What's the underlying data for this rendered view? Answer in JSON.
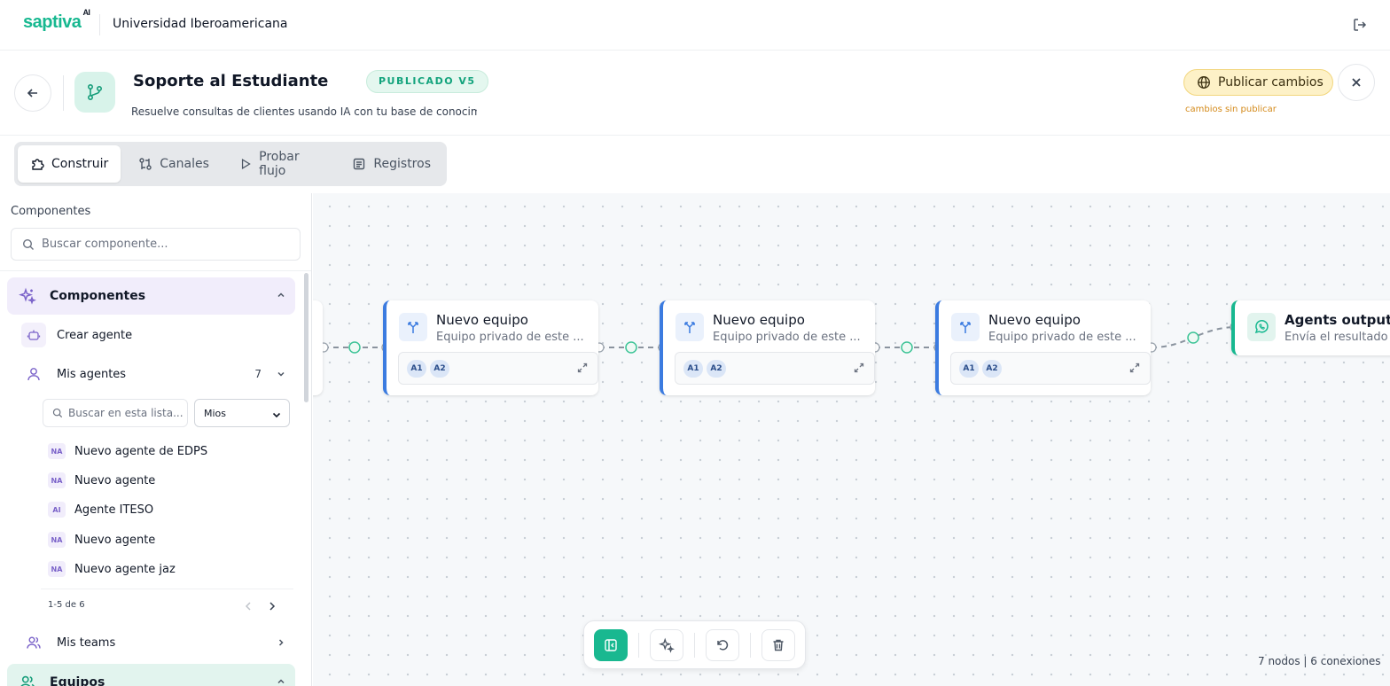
{
  "topbar": {
    "logo": "saptiva",
    "logo_sup": "AI",
    "org_name": "Universidad Iberoamericana"
  },
  "header": {
    "title": "Soporte al Estudiante",
    "status": "PUBLICADO V5",
    "description": "Resuelve consultas de clientes usando IA con tu base de conocimiento",
    "publish_label": "Publicar cambios",
    "unpublished_note": "cambios sin publicar"
  },
  "tabs": [
    {
      "label": "Construir",
      "active": true
    },
    {
      "label": "Canales",
      "active": false
    },
    {
      "label": "Probar flujo",
      "active": false
    },
    {
      "label": "Registros",
      "active": false
    }
  ],
  "sidebar": {
    "title": "Componentes",
    "search_placeholder": "Buscar componente...",
    "components_section": "Componentes",
    "create_agent": "Crear agente",
    "my_agents": "Mis agentes",
    "my_agents_count": "7",
    "list_search_placeholder": "Buscar en esta lista...",
    "list_filter": "Mios",
    "agents": [
      {
        "initials": "NA",
        "name": "Nuevo agente de EDPS"
      },
      {
        "initials": "NA",
        "name": "Nuevo agente"
      },
      {
        "initials": "AI",
        "name": "Agente ITESO"
      },
      {
        "initials": "NA",
        "name": "Nuevo agente"
      },
      {
        "initials": "NA",
        "name": "Nuevo agente jaz"
      }
    ],
    "pager": "1-5 de 6",
    "my_teams": "Mis teams",
    "teams_section": "Equipos"
  },
  "canvas": {
    "nodes": [
      {
        "title": "Nuevo equipo",
        "subtitle": "Equipo privado de este ...",
        "chips": [
          "A1",
          "A2"
        ]
      },
      {
        "title": "Nuevo equipo",
        "subtitle": "Equipo privado de este ...",
        "chips": [
          "A1",
          "A2"
        ]
      },
      {
        "title": "Nuevo equipo",
        "subtitle": "Equipo privado de este ...",
        "chips": [
          "A1",
          "A2"
        ]
      }
    ],
    "output": {
      "title": "Agents output",
      "subtitle": "Envía el resultado de"
    },
    "stats": "7 nodos | 6 conexiones"
  },
  "colors": {
    "brand": "#17b890",
    "node_accent": "#3b7be0",
    "warning": "#d48a1a"
  },
  "icons": [
    "logout-icon",
    "arrow-left-icon",
    "flow-branch-icon",
    "globe-icon",
    "close-icon",
    "puzzle-icon",
    "channels-icon",
    "play-icon",
    "logs-icon",
    "search-icon",
    "sparkles-icon",
    "robot-icon",
    "user-icon",
    "chevron-up-icon",
    "chevron-down-icon",
    "chevron-left-icon",
    "chevron-right-icon",
    "users-icon",
    "split-icon",
    "expand-icon",
    "whatsapp-icon",
    "sidebar-toggle-icon",
    "undo-icon",
    "trash-icon"
  ]
}
